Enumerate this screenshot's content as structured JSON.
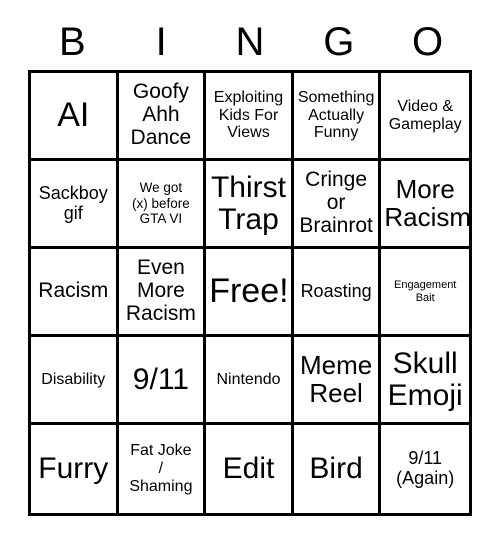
{
  "card": {
    "title_letters": [
      "B",
      "I",
      "N",
      "G",
      "O"
    ],
    "columns": 5,
    "rows": 5,
    "free_space_label": "Free!",
    "text_color": "#000000",
    "background_color": "#ffffff",
    "border_color": "#000000"
  },
  "cells": [
    {
      "text": "AI",
      "size": "fs-4xl"
    },
    {
      "text": "Goofy\nAhh\nDance",
      "size": "fs-xl"
    },
    {
      "text": "Exploiting\nKids For\nViews",
      "size": "fs-md"
    },
    {
      "text": "Something\nActually\nFunny",
      "size": "fs-md"
    },
    {
      "text": "Video &\nGameplay",
      "size": "fs-md"
    },
    {
      "text": "Sackboy\ngif",
      "size": "fs-lg"
    },
    {
      "text": "We got\n(x) before\nGTA VI",
      "size": "fs-sm"
    },
    {
      "text": "Thirst\nTrap",
      "size": "fs-3xl"
    },
    {
      "text": "Cringe\nor\nBrainrot",
      "size": "fs-xl"
    },
    {
      "text": "More\nRacism",
      "size": "fs-2xl"
    },
    {
      "text": "Racism",
      "size": "fs-xl"
    },
    {
      "text": "Even\nMore\nRacism",
      "size": "fs-xl"
    },
    {
      "text": "Free!",
      "size": "fs-4xl"
    },
    {
      "text": "Roasting",
      "size": "fs-lg"
    },
    {
      "text": "Engagement\nBait",
      "size": "fs-xs"
    },
    {
      "text": "Disability",
      "size": "fs-md"
    },
    {
      "text": "9/11",
      "size": "fs-3xl"
    },
    {
      "text": "Nintendo",
      "size": "fs-md"
    },
    {
      "text": "Meme\nReel",
      "size": "fs-2xl"
    },
    {
      "text": "Skull\nEmoji",
      "size": "fs-3xl"
    },
    {
      "text": "Furry",
      "size": "fs-3xl"
    },
    {
      "text": "Fat Joke\n/\nShaming",
      "size": "fs-md"
    },
    {
      "text": "Edit",
      "size": "fs-3xl"
    },
    {
      "text": "Bird",
      "size": "fs-3xl"
    },
    {
      "text": "9/11\n(Again)",
      "size": "fs-lg"
    }
  ]
}
